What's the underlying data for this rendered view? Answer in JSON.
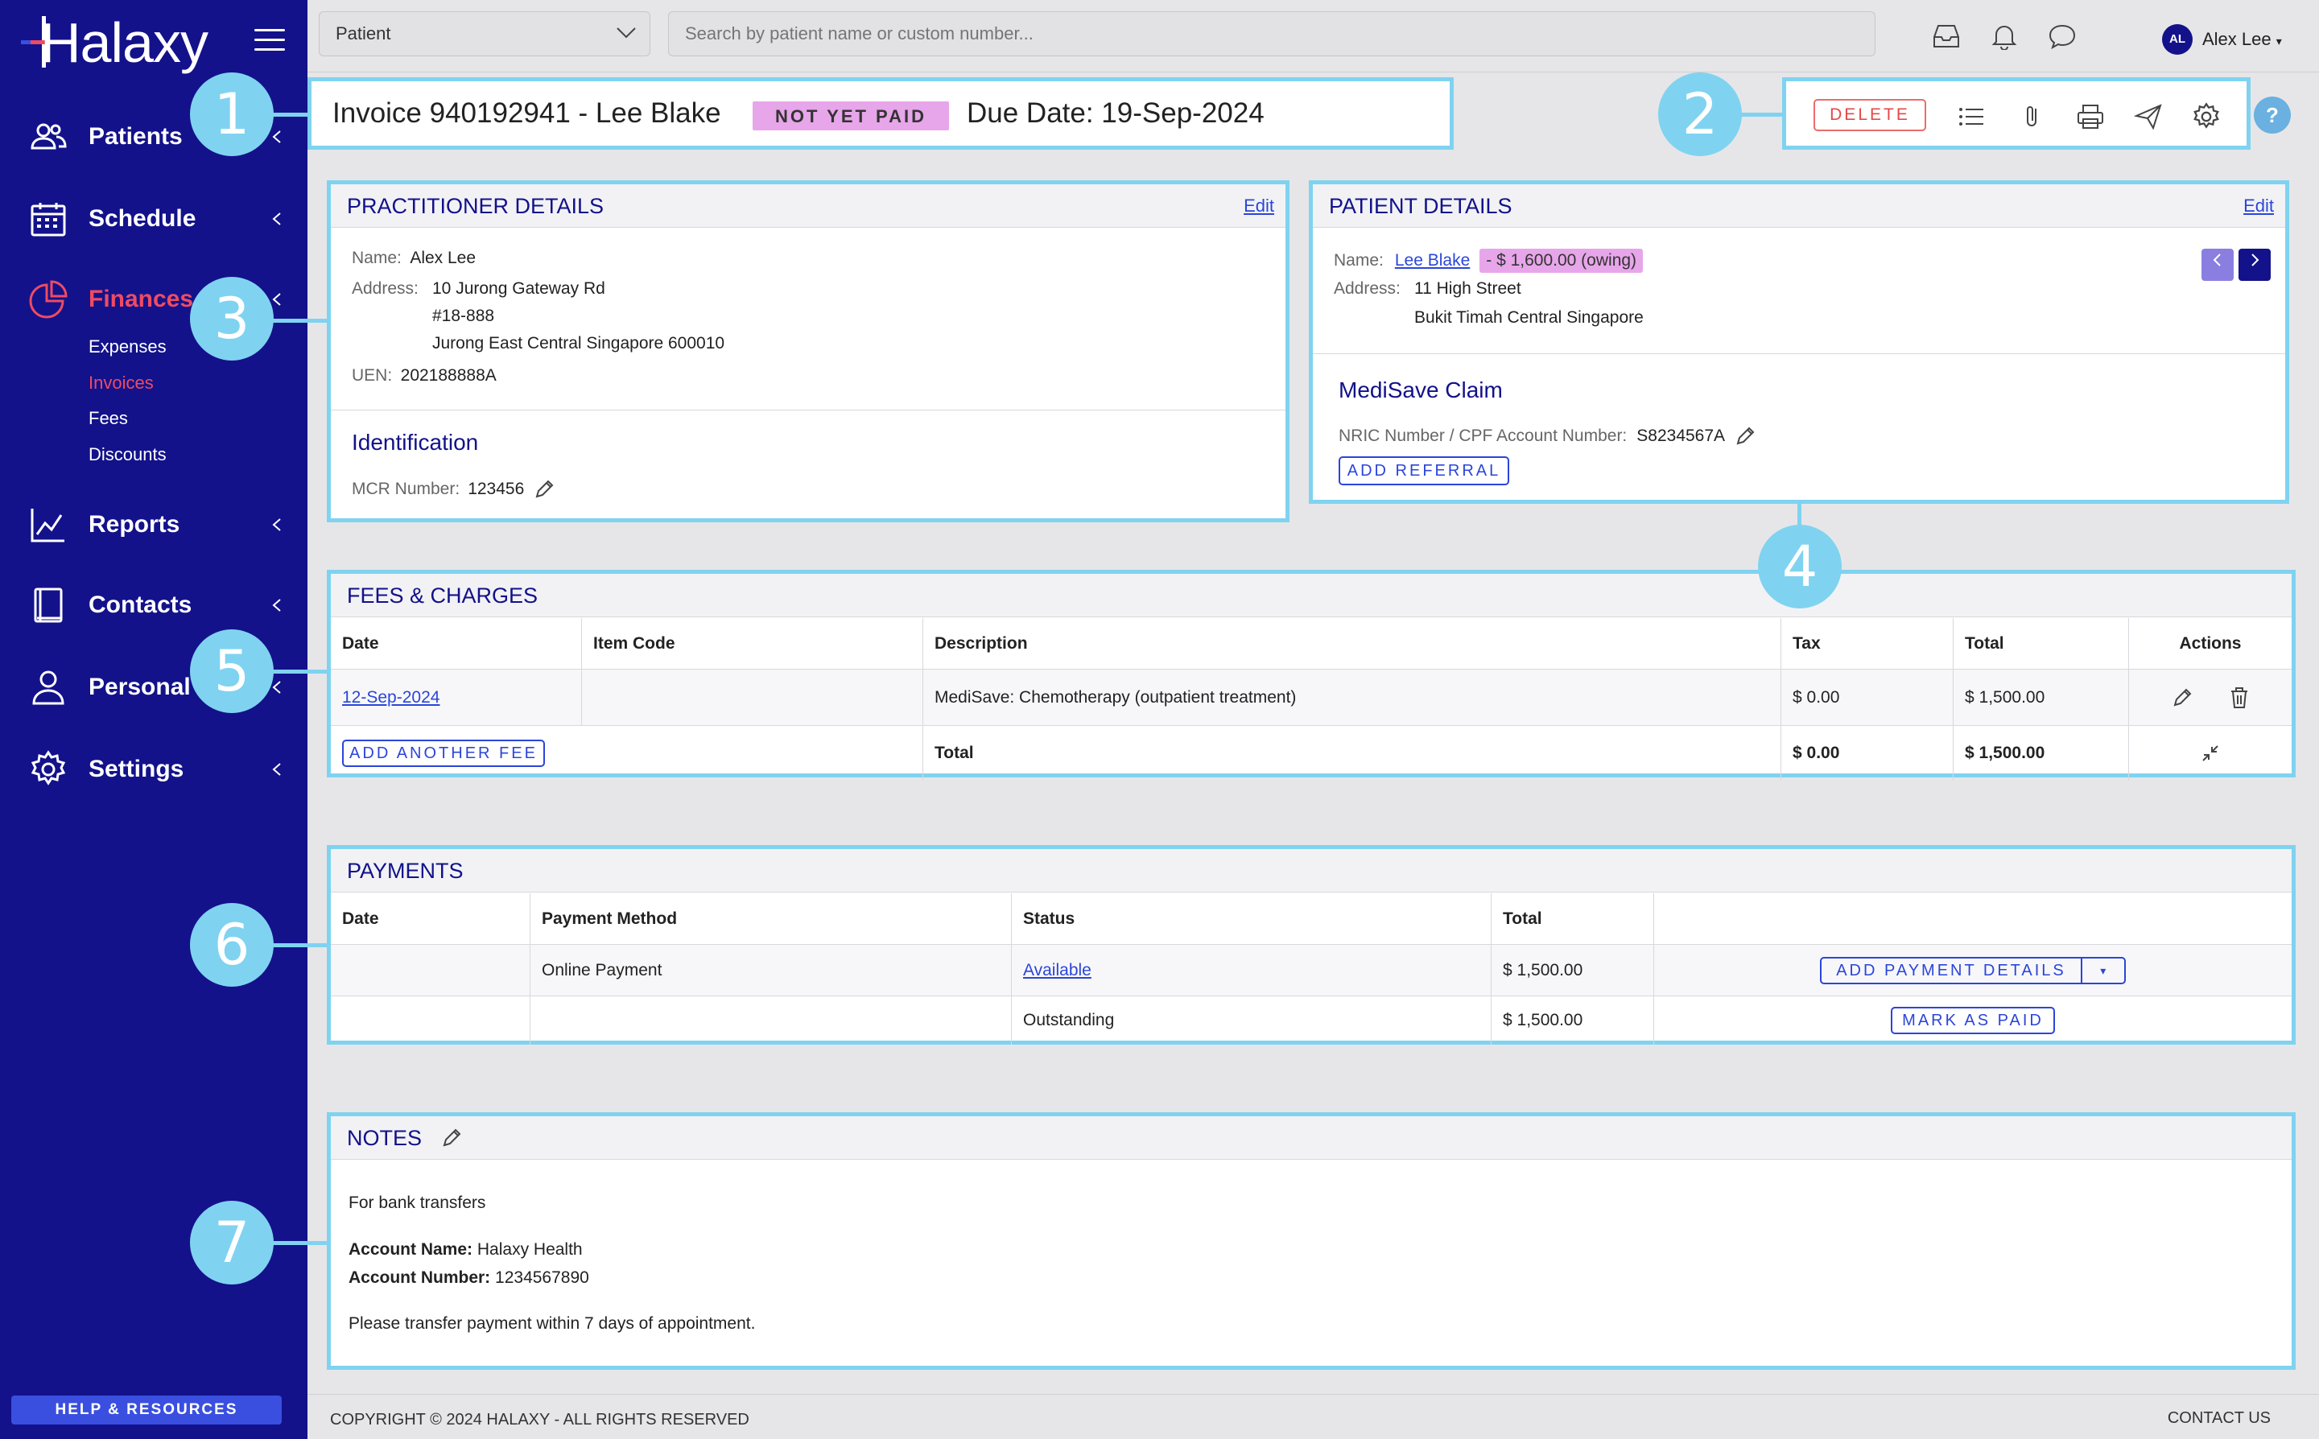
{
  "sidebar": {
    "logo": "Halaxy",
    "nav": [
      {
        "label": "Patients",
        "icon": "people-icon"
      },
      {
        "label": "Schedule",
        "icon": "calendar-icon"
      },
      {
        "label": "Finances",
        "icon": "pie-chart-icon"
      },
      {
        "label": "Reports",
        "icon": "line-chart-icon"
      },
      {
        "label": "Contacts",
        "icon": "address-book-icon"
      },
      {
        "label": "Personal",
        "icon": "person-icon"
      },
      {
        "label": "Settings",
        "icon": "gear-icon"
      }
    ],
    "finances_sub": [
      "Expenses",
      "Invoices",
      "Fees",
      "Discounts"
    ],
    "help_label": "HELP & RESOURCES"
  },
  "topbar": {
    "patient_select": "Patient",
    "search_placeholder": "Search by patient name or custom number...",
    "user_initials": "AL",
    "user_name": "Alex Lee"
  },
  "header": {
    "title": "Invoice 940192941 - Lee Blake",
    "status": "NOT YET PAID",
    "due_date": "Due Date: 19-Sep-2024"
  },
  "toolbar": {
    "delete_label": "DELETE",
    "help": "?"
  },
  "practitioner": {
    "heading": "PRACTITIONER DETAILS",
    "edit": "Edit",
    "name_label": "Name:",
    "name": "Alex Lee",
    "address_label": "Address:",
    "address_1": "10 Jurong Gateway Rd",
    "address_2": "#18-888",
    "address_3": "Jurong East Central Singapore 600010",
    "uen_label": "UEN:",
    "uen": "202188888A",
    "identification_heading": "Identification",
    "mcr_label": "MCR Number:",
    "mcr": "123456"
  },
  "patient": {
    "heading": "PATIENT DETAILS",
    "edit": "Edit",
    "name_label": "Name:",
    "name": "Lee Blake",
    "owing": "- $ 1,600.00 (owing)",
    "address_label": "Address:",
    "address_1": "11 High Street",
    "address_2": "Bukit Timah Central Singapore",
    "claim_heading": "MediSave Claim",
    "nric_label": "NRIC Number / CPF Account Number:",
    "nric": "S8234567A",
    "add_referral": "ADD REFERRAL"
  },
  "fees": {
    "heading": "FEES & CHARGES",
    "columns": [
      "Date",
      "Item Code",
      "Description",
      "Tax",
      "Total",
      "Actions"
    ],
    "rows": [
      {
        "date": "12-Sep-2024",
        "code": "",
        "description": "MediSave: Chemotherapy (outpatient treatment)",
        "tax": "$ 0.00",
        "total": "$ 1,500.00"
      }
    ],
    "add_fee": "ADD ANOTHER FEE",
    "total_label": "Total",
    "total_tax": "$ 0.00",
    "total_amount": "$ 1,500.00"
  },
  "payments": {
    "heading": "PAYMENTS",
    "columns": [
      "Date",
      "Payment Method",
      "Status",
      "Total"
    ],
    "rows": [
      {
        "date": "",
        "method": "Online Payment",
        "status": "Available",
        "total": "$ 1,500.00",
        "action": "ADD PAYMENT DETAILS"
      },
      {
        "date": "",
        "method": "",
        "status": "Outstanding",
        "total": "$ 1,500.00",
        "action": "MARK AS PAID"
      }
    ]
  },
  "notes": {
    "heading": "NOTES",
    "line1": "For bank transfers",
    "acct_name_label": "Account Name:",
    "acct_name": "Halaxy Health",
    "acct_num_label": "Account Number:",
    "acct_num": "1234567890",
    "line3": "Please transfer payment within 7 days of appointment."
  },
  "callouts": [
    "1",
    "2",
    "3",
    "4",
    "5",
    "6",
    "7"
  ],
  "footer": {
    "copyright": "COPYRIGHT © 2024 HALAXY - ALL RIGHTS RESERVED",
    "contact": "CONTACT US"
  },
  "colors": {
    "sidebar": "#13128b",
    "accent_red": "#ee4b62",
    "callout": "#7fd3f0",
    "status_badge": "#e7a6e9",
    "link": "#2b45d9"
  }
}
